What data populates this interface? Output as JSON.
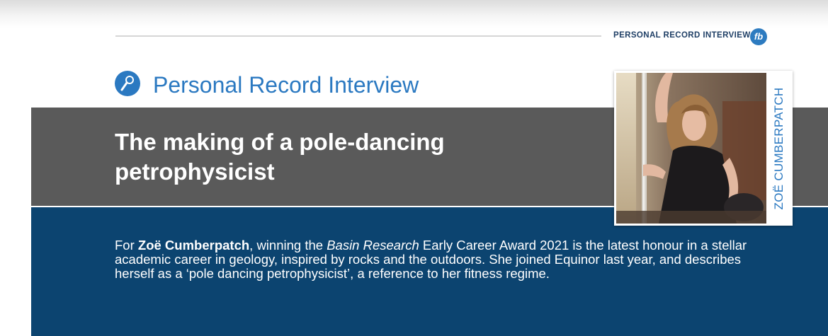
{
  "header": {
    "label": "PERSONAL RECORD INTERVIEW",
    "logo_text": "fb"
  },
  "section": {
    "title_bold": "Personal Record",
    "title_light": "Interview",
    "icon": "microphone-icon"
  },
  "article": {
    "headline_line1": "The making of a pole-dancing",
    "headline_line2": "petrophysicist",
    "lead_part1": "For ",
    "lead_name": "Zoë Cumberpatch",
    "lead_part2": ", winning the ",
    "lead_journal": "Basin Research",
    "lead_part3": " Early Career Award 2021 is the latest honour in a stellar academic career in geology, inspired by rocks and the outdoors. She joined Equinor last year, and describes herself as a ‘pole dancing petrophysicist’, a reference to her fitness regime."
  },
  "photo": {
    "caption": "ZOË CUMBERPATCH",
    "alt": "portrait-photo"
  },
  "colors": {
    "accent_blue": "#2b79c1",
    "navy_band": "#0c4470",
    "grey_band": "#5a5a5a",
    "header_text": "#1f3f66"
  }
}
